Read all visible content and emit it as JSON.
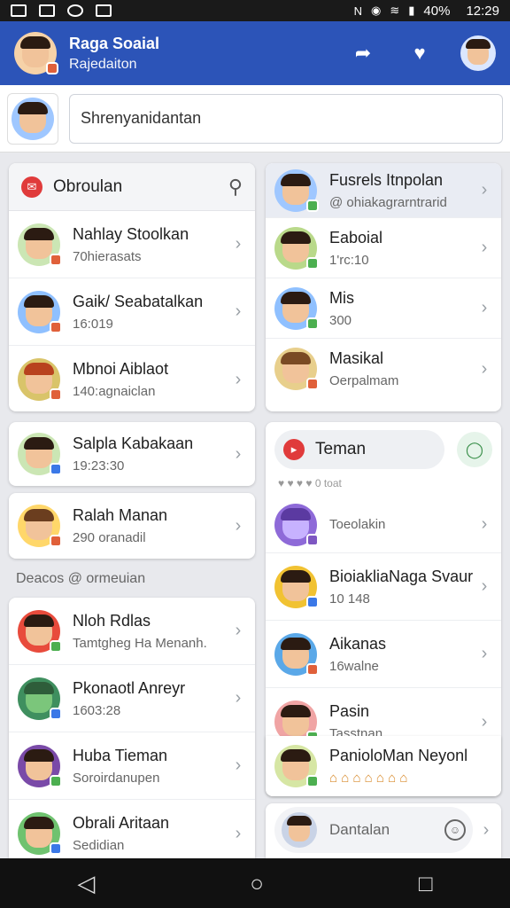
{
  "status_bar": {
    "battery": "40%",
    "time": "12:29"
  },
  "app_bar": {
    "title": "Raga Soaial",
    "subtitle": "Rajedaiton"
  },
  "search": {
    "value": "Shrenyanidantan"
  },
  "chats": {
    "header": "Obroulan",
    "items": [
      {
        "name": "Nahlay Stoolkan",
        "sub": "70hierasats",
        "status_color": "#e0603a"
      },
      {
        "name": "Gaik/ Seabatalkan",
        "sub": "16:019",
        "status_color": "#e0603a"
      },
      {
        "name": "Mbnoi Aiblaot",
        "sub": "140:agnaiclan",
        "status_color": "#e0603a"
      }
    ]
  },
  "groups": {
    "items": [
      {
        "name": "Fusrels Itnpolan",
        "sub": "@ ohiakagrarntrarid",
        "status_color": "#4caf50"
      },
      {
        "name": "Eaboial",
        "sub": "1'rc:10",
        "status_color": "#4caf50"
      },
      {
        "name": "Mis",
        "sub": "300",
        "status_color": "#4caf50"
      },
      {
        "name": "Masikal",
        "sub": "Oerpalmam",
        "status_color": "#e0603a"
      }
    ]
  },
  "single_cards": [
    {
      "name": "Salpla Kabakaan",
      "sub": "19:23:30",
      "status_color": "#3b78e7"
    },
    {
      "name": "Ralah Manan",
      "sub": "290 oranadil",
      "status_color": "#e0603a"
    }
  ],
  "section_label": "Deacos @ ormeuian",
  "contacts": {
    "items": [
      {
        "name": "Nloh Rdlas",
        "sub": "Tamtgheg Ha Menanh.",
        "status_color": "#4caf50"
      },
      {
        "name": "Pkonaotl Anreyr",
        "sub": "1603:28",
        "status_color": "#3b78e7"
      },
      {
        "name": "Huba Tieman",
        "sub": "Soroirdanupen",
        "status_color": "#4caf50"
      },
      {
        "name": "Obrali Aritaan",
        "sub": "Sedidian",
        "status_color": "#3b78e7"
      }
    ]
  },
  "friends": {
    "header": "Teman",
    "reactions": "0 toat",
    "items": [
      {
        "name": "",
        "sub": "Toeolakin",
        "status_color": "#7e57c2"
      },
      {
        "name": "BioiakliaNaga Svaur",
        "sub": "10 148",
        "status_color": "#3b78e7"
      },
      {
        "name": "Aikanas",
        "sub": "16walne",
        "status_color": "#e0603a"
      },
      {
        "name": "Pasin",
        "sub": "Tasstnan",
        "status_color": "#4caf50"
      },
      {
        "name": "PanioloMan Neyonl",
        "sub": "",
        "status_color": "#4caf50"
      }
    ],
    "bottom_label": "Dantalan"
  },
  "nav": {
    "back": "◁",
    "home": "○",
    "recents": "□"
  }
}
